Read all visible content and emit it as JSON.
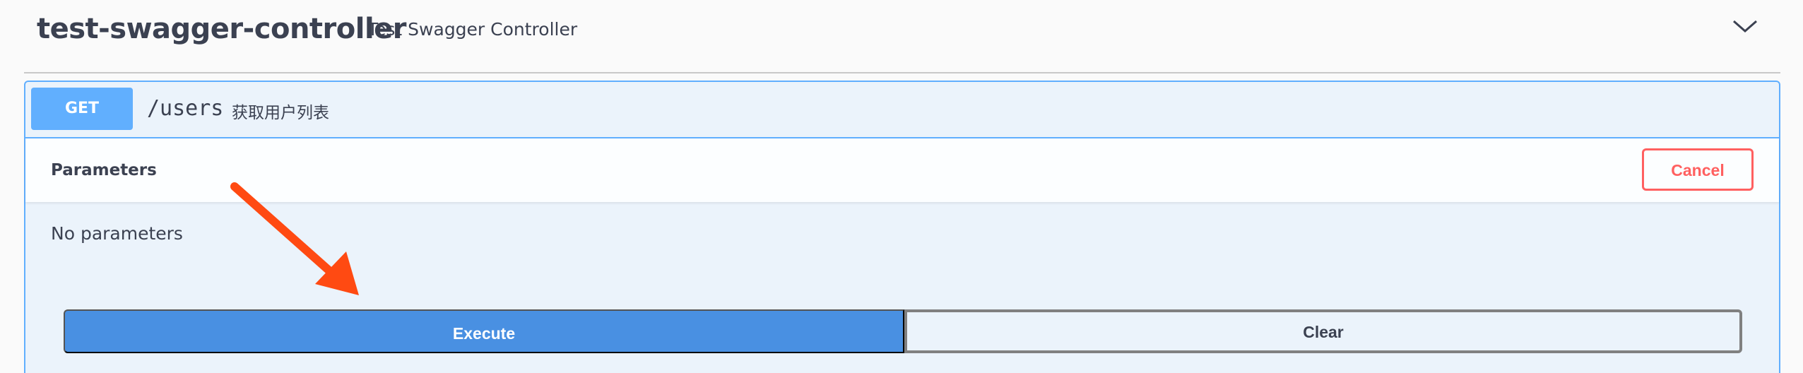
{
  "section": {
    "title": "test-swagger-controller",
    "description": "Test Swagger Controller",
    "collapse_icon": "chevron-down-icon"
  },
  "operation": {
    "method": "GET",
    "path": "/users",
    "summary": "获取用户列表"
  },
  "parameters": {
    "title": "Parameters",
    "cancel_label": "Cancel",
    "empty_text": "No parameters"
  },
  "actions": {
    "execute_label": "Execute",
    "clear_label": "Clear"
  },
  "colors": {
    "method_get": "#61affe",
    "execute": "#4990e2",
    "cancel": "#ff6060",
    "annotation_arrow": "#ff4a12"
  },
  "annotation": {
    "icon": "arrow-annotation-icon"
  }
}
